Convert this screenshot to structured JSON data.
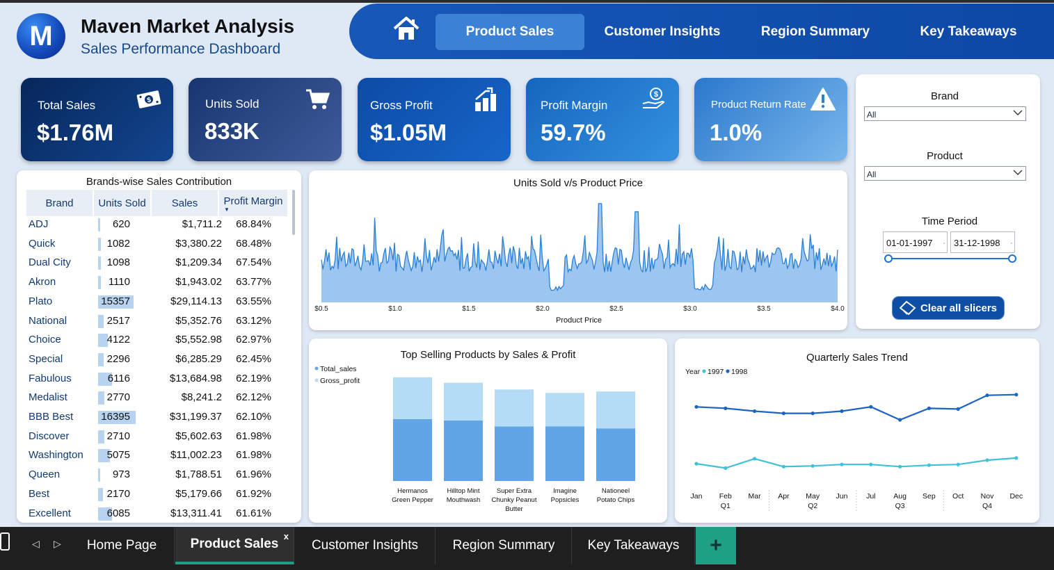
{
  "header": {
    "logo_letter": "M",
    "title": "Maven Market Analysis",
    "subtitle": "Sales Performance Dashboard"
  },
  "nav": {
    "home_icon": "home-icon",
    "items": [
      {
        "label": "Product Sales",
        "active": true
      },
      {
        "label": "Customer Insights",
        "active": false
      },
      {
        "label": "Region Summary",
        "active": false
      },
      {
        "label": "Key Takeaways",
        "active": false
      }
    ]
  },
  "kpis": [
    {
      "label": "Total Sales",
      "value": "$1.76M",
      "icon": "cash-icon"
    },
    {
      "label": "Units Sold",
      "value": "833K",
      "icon": "cart-icon"
    },
    {
      "label": "Gross Profit",
      "value": "$1.05M",
      "icon": "growth-icon"
    },
    {
      "label": "Profit Margin",
      "value": "59.7%",
      "icon": "dollar-hand-icon"
    },
    {
      "label": "Product Return Rate",
      "value": "1.0%",
      "icon": "warning-icon"
    }
  ],
  "brand_table": {
    "title": "Brands-wise Sales Contribution",
    "columns": [
      "Brand",
      "Units Sold",
      "Sales",
      "Profit Margin"
    ],
    "units_max": 16395,
    "rows": [
      {
        "brand": "ADJ",
        "units": "620",
        "units_n": 620,
        "sales": "$1,711.2",
        "pm": "68.84%"
      },
      {
        "brand": "Quick",
        "units": "1082",
        "units_n": 1082,
        "sales": "$3,380.22",
        "pm": "68.48%"
      },
      {
        "brand": "Dual City",
        "units": "1098",
        "units_n": 1098,
        "sales": "$1,209.34",
        "pm": "67.54%"
      },
      {
        "brand": "Akron",
        "units": "1110",
        "units_n": 1110,
        "sales": "$1,943.02",
        "pm": "63.77%"
      },
      {
        "brand": "Plato",
        "units": "15357",
        "units_n": 15357,
        "sales": "$29,114.13",
        "pm": "63.55%"
      },
      {
        "brand": "National",
        "units": "2517",
        "units_n": 2517,
        "sales": "$5,352.76",
        "pm": "63.12%"
      },
      {
        "brand": "Choice",
        "units": "4122",
        "units_n": 4122,
        "sales": "$5,552.98",
        "pm": "62.97%"
      },
      {
        "brand": "Special",
        "units": "2296",
        "units_n": 2296,
        "sales": "$6,285.29",
        "pm": "62.45%"
      },
      {
        "brand": "Fabulous",
        "units": "6116",
        "units_n": 6116,
        "sales": "$13,684.98",
        "pm": "62.19%"
      },
      {
        "brand": "Medalist",
        "units": "2770",
        "units_n": 2770,
        "sales": "$8,241.2",
        "pm": "62.12%"
      },
      {
        "brand": "BBB Best",
        "units": "16395",
        "units_n": 16395,
        "sales": "$31,199.37",
        "pm": "62.10%"
      },
      {
        "brand": "Discover",
        "units": "2710",
        "units_n": 2710,
        "sales": "$5,602.63",
        "pm": "61.98%"
      },
      {
        "brand": "Washington",
        "units": "5075",
        "units_n": 5075,
        "sales": "$11,002.23",
        "pm": "61.98%"
      },
      {
        "brand": "Queen",
        "units": "973",
        "units_n": 973,
        "sales": "$1,788.51",
        "pm": "61.96%"
      },
      {
        "brand": "Best",
        "units": "2170",
        "units_n": 2170,
        "sales": "$5,179.66",
        "pm": "61.92%"
      },
      {
        "brand": "Excellent",
        "units": "6085",
        "units_n": 6085,
        "sales": "$13,311.41",
        "pm": "61.61%"
      }
    ]
  },
  "slicers": {
    "brand_label": "Brand",
    "brand_value": "All",
    "product_label": "Product",
    "product_value": "All",
    "period_label": "Time Period",
    "date_start": "01-01-1997",
    "date_end": "31-12-1998",
    "clear_label": "Clear all slicers"
  },
  "chart_data": [
    {
      "type": "area",
      "title": "Units Sold v/s Product Price",
      "xlabel": "Product Price",
      "ylabel": "",
      "xlim": [
        0.5,
        4.0
      ],
      "x_ticks": [
        "$0.5",
        "$1.0",
        "$1.5",
        "$2.0",
        "$2.5",
        "$3.0",
        "$3.5",
        "$4.0"
      ],
      "seed": 7,
      "points": 340,
      "color": "#2a7fd6",
      "fill": "#9cc6ef"
    },
    {
      "type": "bar",
      "title": "Top Selling Products by Sales & Profit",
      "stacked": true,
      "categories": [
        "Hermanos Green Pepper",
        "Hilltop Mint Mouthwash",
        "Super Extra Chunky Peanut Butter",
        "Imagine Popsicles",
        "Nationeel Potato Chips"
      ],
      "category_lines": [
        [
          "Hermanos",
          "Green Pepper"
        ],
        [
          "Hilltop Mint",
          "Mouthwash"
        ],
        [
          "Super Extra",
          "Chunky Peanut",
          "Butter"
        ],
        [
          "Imagine",
          "Popsicles"
        ],
        [
          "Nationeel",
          "Potato Chips"
        ]
      ],
      "series": [
        {
          "name": "Total_sales",
          "color": "#62a5e6",
          "values": [
            92,
            90,
            81,
            81,
            78
          ]
        },
        {
          "name": "Gross_profit",
          "color": "#b4dcf7",
          "values": [
            62,
            56,
            55,
            50,
            55
          ]
        }
      ],
      "ylim": [
        0,
        160
      ]
    },
    {
      "type": "line",
      "title": "Quarterly Sales Trend",
      "legend_title": "Year",
      "categories": [
        "Jan",
        "Feb",
        "Mar",
        "Apr",
        "May",
        "Jun",
        "Jul",
        "Aug",
        "Sep",
        "Oct",
        "Nov",
        "Dec"
      ],
      "quarter_labels": [
        "Q1",
        "Q2",
        "Q3",
        "Q4"
      ],
      "series": [
        {
          "name": "1997",
          "color": "#3fc1d9",
          "values": [
            49,
            43,
            56,
            45,
            46,
            48,
            48,
            45,
            47,
            48,
            54,
            57
          ]
        },
        {
          "name": "1998",
          "color": "#1c64c4",
          "values": [
            128,
            126,
            122,
            119,
            119,
            122,
            128,
            110,
            126,
            125,
            144,
            145
          ]
        }
      ],
      "ylim": [
        25,
        165
      ]
    }
  ],
  "tabs": {
    "items": [
      {
        "label": "Home Page",
        "active": false
      },
      {
        "label": "Product Sales",
        "active": true
      },
      {
        "label": "Customer Insights",
        "active": false
      },
      {
        "label": "Region Summary",
        "active": false
      },
      {
        "label": "Key Takeaways",
        "active": false
      }
    ],
    "close_glyph": "x",
    "add_glyph": "+"
  }
}
